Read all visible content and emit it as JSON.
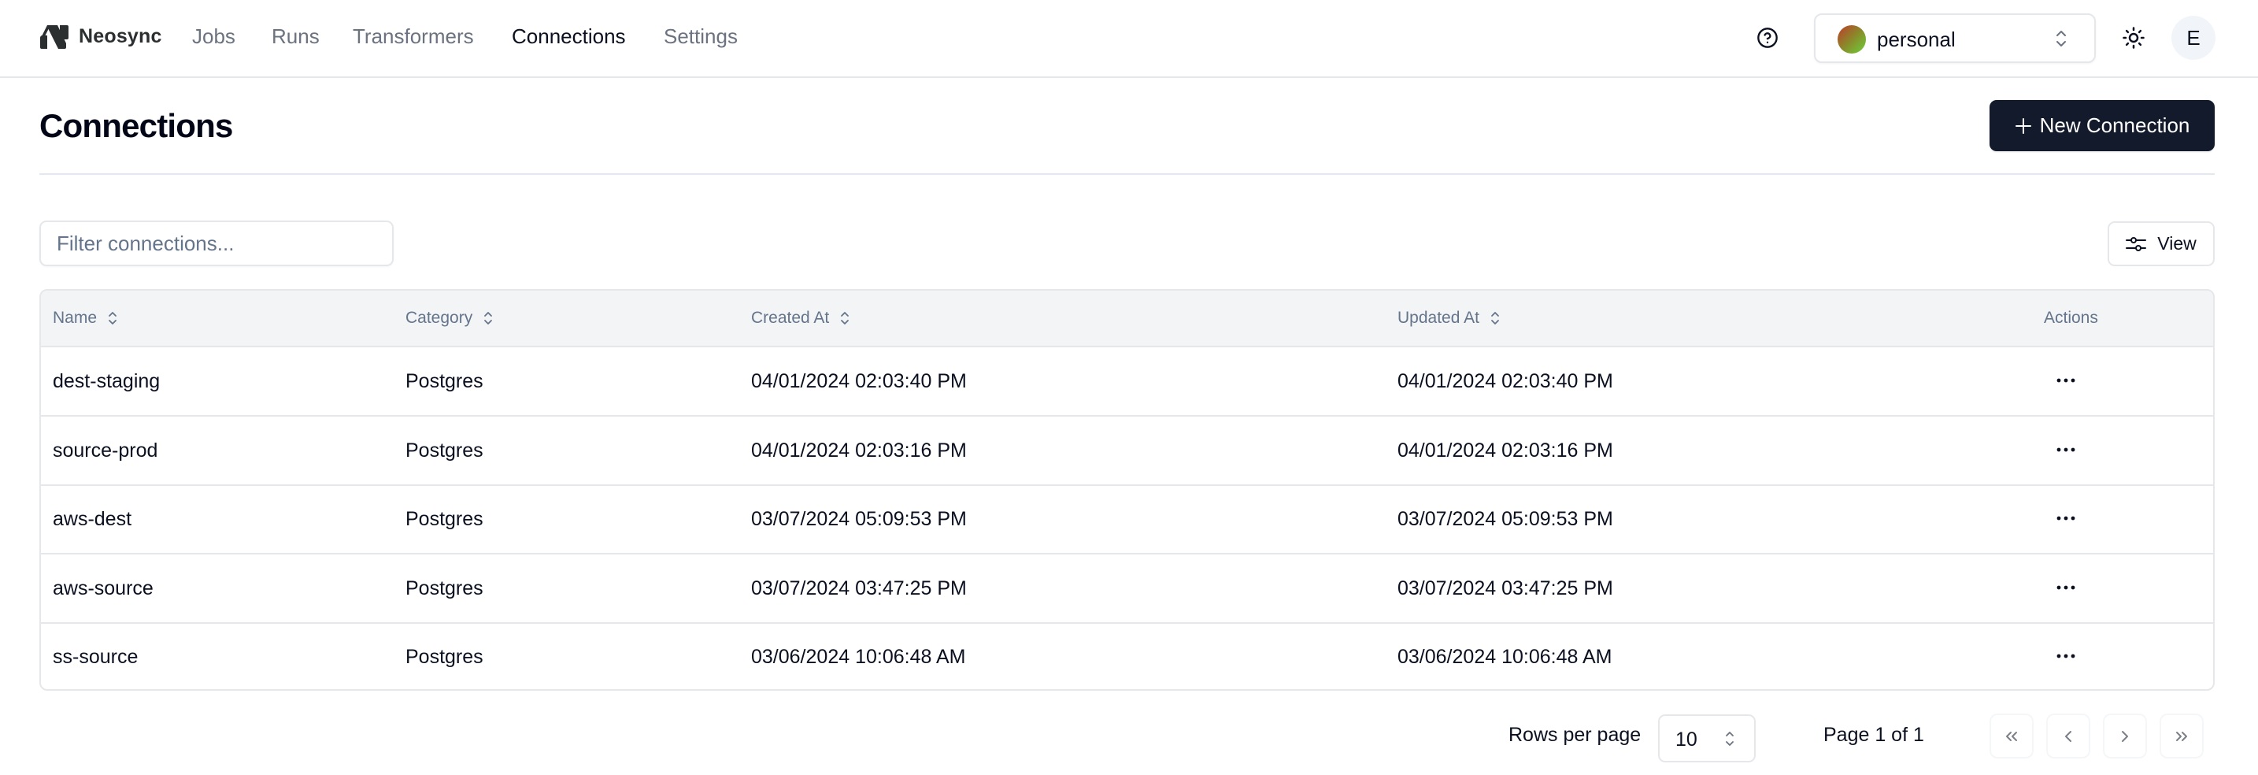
{
  "nav": {
    "brand": "Neosync",
    "links": [
      {
        "label": "Jobs",
        "active": false
      },
      {
        "label": "Runs",
        "active": false
      },
      {
        "label": "Transformers",
        "active": false
      },
      {
        "label": "Connections",
        "active": true
      },
      {
        "label": "Settings",
        "active": false
      }
    ],
    "account": {
      "label": "personal"
    },
    "avatar_initial": "E",
    "icons": {
      "help": "help-circle-icon",
      "theme": "sun-icon",
      "account_chevron": "chevrons-up-down-icon"
    }
  },
  "page": {
    "title": "Connections",
    "new_button_label": "New Connection",
    "accent_color": "#131a2c"
  },
  "toolbar": {
    "filter_placeholder": "Filter connections...",
    "filter_value": "",
    "view_label": "View"
  },
  "table": {
    "columns": [
      {
        "label": "Name",
        "sortable": true
      },
      {
        "label": "Category",
        "sortable": true
      },
      {
        "label": "Created At",
        "sortable": true
      },
      {
        "label": "Updated At",
        "sortable": true
      },
      {
        "label": "Actions",
        "sortable": false
      }
    ],
    "rows": [
      {
        "name": "dest-staging",
        "category": "Postgres",
        "created_at": "04/01/2024 02:03:40 PM",
        "updated_at": "04/01/2024 02:03:40 PM"
      },
      {
        "name": "source-prod",
        "category": "Postgres",
        "created_at": "04/01/2024 02:03:16 PM",
        "updated_at": "04/01/2024 02:03:16 PM"
      },
      {
        "name": "aws-dest",
        "category": "Postgres",
        "created_at": "03/07/2024 05:09:53 PM",
        "updated_at": "03/07/2024 05:09:53 PM"
      },
      {
        "name": "aws-source",
        "category": "Postgres",
        "created_at": "03/07/2024 03:47:25 PM",
        "updated_at": "03/07/2024 03:47:25 PM"
      },
      {
        "name": "ss-source",
        "category": "Postgres",
        "created_at": "03/06/2024 10:06:48 AM",
        "updated_at": "03/06/2024 10:06:48 AM"
      }
    ]
  },
  "pagination": {
    "rows_per_page_label": "Rows per page",
    "rows_per_page_value": "10",
    "page_info": "Page 1 of 1",
    "current_page": 1,
    "total_pages": 1
  }
}
